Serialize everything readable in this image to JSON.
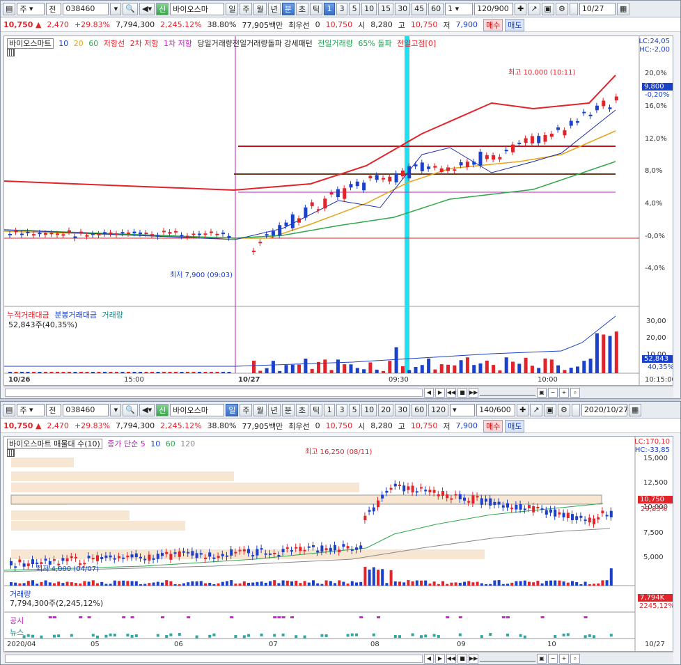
{
  "w1": {
    "toolbar": {
      "type": "주",
      "mode": "전",
      "code": "038460",
      "badge": "신",
      "name": "바이오스마",
      "periods": [
        "일",
        "주",
        "월",
        "년",
        "분",
        "초",
        "틱"
      ],
      "nums": [
        "1",
        "3",
        "5",
        "10",
        "15",
        "30",
        "45",
        "60"
      ],
      "unit": "1",
      "count": "120/900",
      "check": "",
      "date": "10/27"
    },
    "quote": {
      "price": "10,750",
      "arrow": "▲",
      "change": "2,470",
      "rate": "+29.83%",
      "volume": "7,794,300",
      "vrate": "2,245.12%",
      "turnover": "38.80%",
      "amount": "77,905백만",
      "pref": "최우선",
      "prefval": "0",
      "bid": "10,750",
      "open_l": "시",
      "open": "8,280",
      "high_l": "고",
      "high": "10,750",
      "low_l": "저",
      "low": "7,900",
      "buy": "매수",
      "sell": "매도"
    },
    "legend": {
      "name": "바이오스마트",
      "ma1": "10",
      "ma2": "20",
      "ma3": "60",
      "l1": "저항선",
      "l2": "2차 저항",
      "l3": "1차 저항",
      "l4": "당일거래량전일거래량돌파 강세패턴",
      "l5": "전일거래량",
      "l6": "65% 돌파",
      "l7": "전일고점[0]"
    },
    "lc": "LC:24,05",
    "hc": "HC:-2,00",
    "y_labels": [
      "20,0%",
      "16,0%",
      "12,0%",
      "8,0%",
      "4,0%",
      "-0,0%",
      "-4,0%"
    ],
    "price_tag": "9,800",
    "pct_tag": "-0,20%",
    "hi_label": "최고 10,000 (10:11)",
    "lo_label": "최저 7,900 (09:03)",
    "vol_legend": {
      "a": "누적거래대금",
      "b": "분봉거래대금",
      "c": "거래량",
      "d": "52,843주(40,35%)"
    },
    "vol_labels": [
      "30,00",
      "20,00",
      "10,00"
    ],
    "vol_tag": "52,843",
    "vol_pct": "40,35%",
    "x_labels": [
      "10/26",
      "15:00",
      "10/27",
      "09:30",
      "10:00",
      "10:15:00"
    ]
  },
  "w2": {
    "toolbar": {
      "type": "주",
      "mode": "전",
      "code": "038460",
      "badge": "신",
      "name": "바이오스마",
      "periods": [
        "일",
        "주",
        "월",
        "년",
        "분",
        "초",
        "틱"
      ],
      "nums": [
        "1",
        "3",
        "5",
        "10",
        "20",
        "30",
        "60",
        "120"
      ],
      "count": "140/600",
      "check": "",
      "date": "2020/10/27"
    },
    "quote": {
      "price": "10,750",
      "arrow": "▲",
      "change": "2,470",
      "rate": "+29.83%",
      "volume": "7,794,300",
      "vrate": "2,245.12%",
      "turnover": "38.80%",
      "amount": "77,905백만",
      "pref": "최우선",
      "prefval": "0",
      "bid": "10,750",
      "open_l": "시",
      "open": "8,280",
      "high_l": "고",
      "high": "10,750",
      "low_l": "저",
      "low": "7,900",
      "buy": "매수",
      "sell": "매도"
    },
    "legend": {
      "name": "바이오스마트 매물대 수(10)",
      "ma": "종가 단순 5",
      "m1": "10",
      "m2": "60",
      "m3": "120"
    },
    "lc": "LC:170,10",
    "hc": "HC:-33,85",
    "y_labels": [
      "15,000",
      "12,500",
      "10,000",
      "7,500",
      "5,000"
    ],
    "price_tag": "10,750",
    "pct_tag": "29,83%",
    "hi_label": "최고 16,250 (08/11)",
    "lo_label": "최저 4,000 (04/07)",
    "vol_legend": {
      "a": "거래량",
      "b": "7,794,300주(2,245,12%)"
    },
    "vol_tag": "7,794K",
    "vol_pct": "2245,12%",
    "ind1": "공시",
    "ind2": "뉴스",
    "x_labels": [
      "2020/04",
      "05",
      "06",
      "07",
      "08",
      "09",
      "10",
      "10/27"
    ]
  },
  "colors": {
    "up": "#e1232a",
    "down": "#1b40c9",
    "ma5": "#1b2fa8",
    "ma20": "#e8a317",
    "ma60": "#2ea84a",
    "cyan": "#22e0ef"
  }
}
